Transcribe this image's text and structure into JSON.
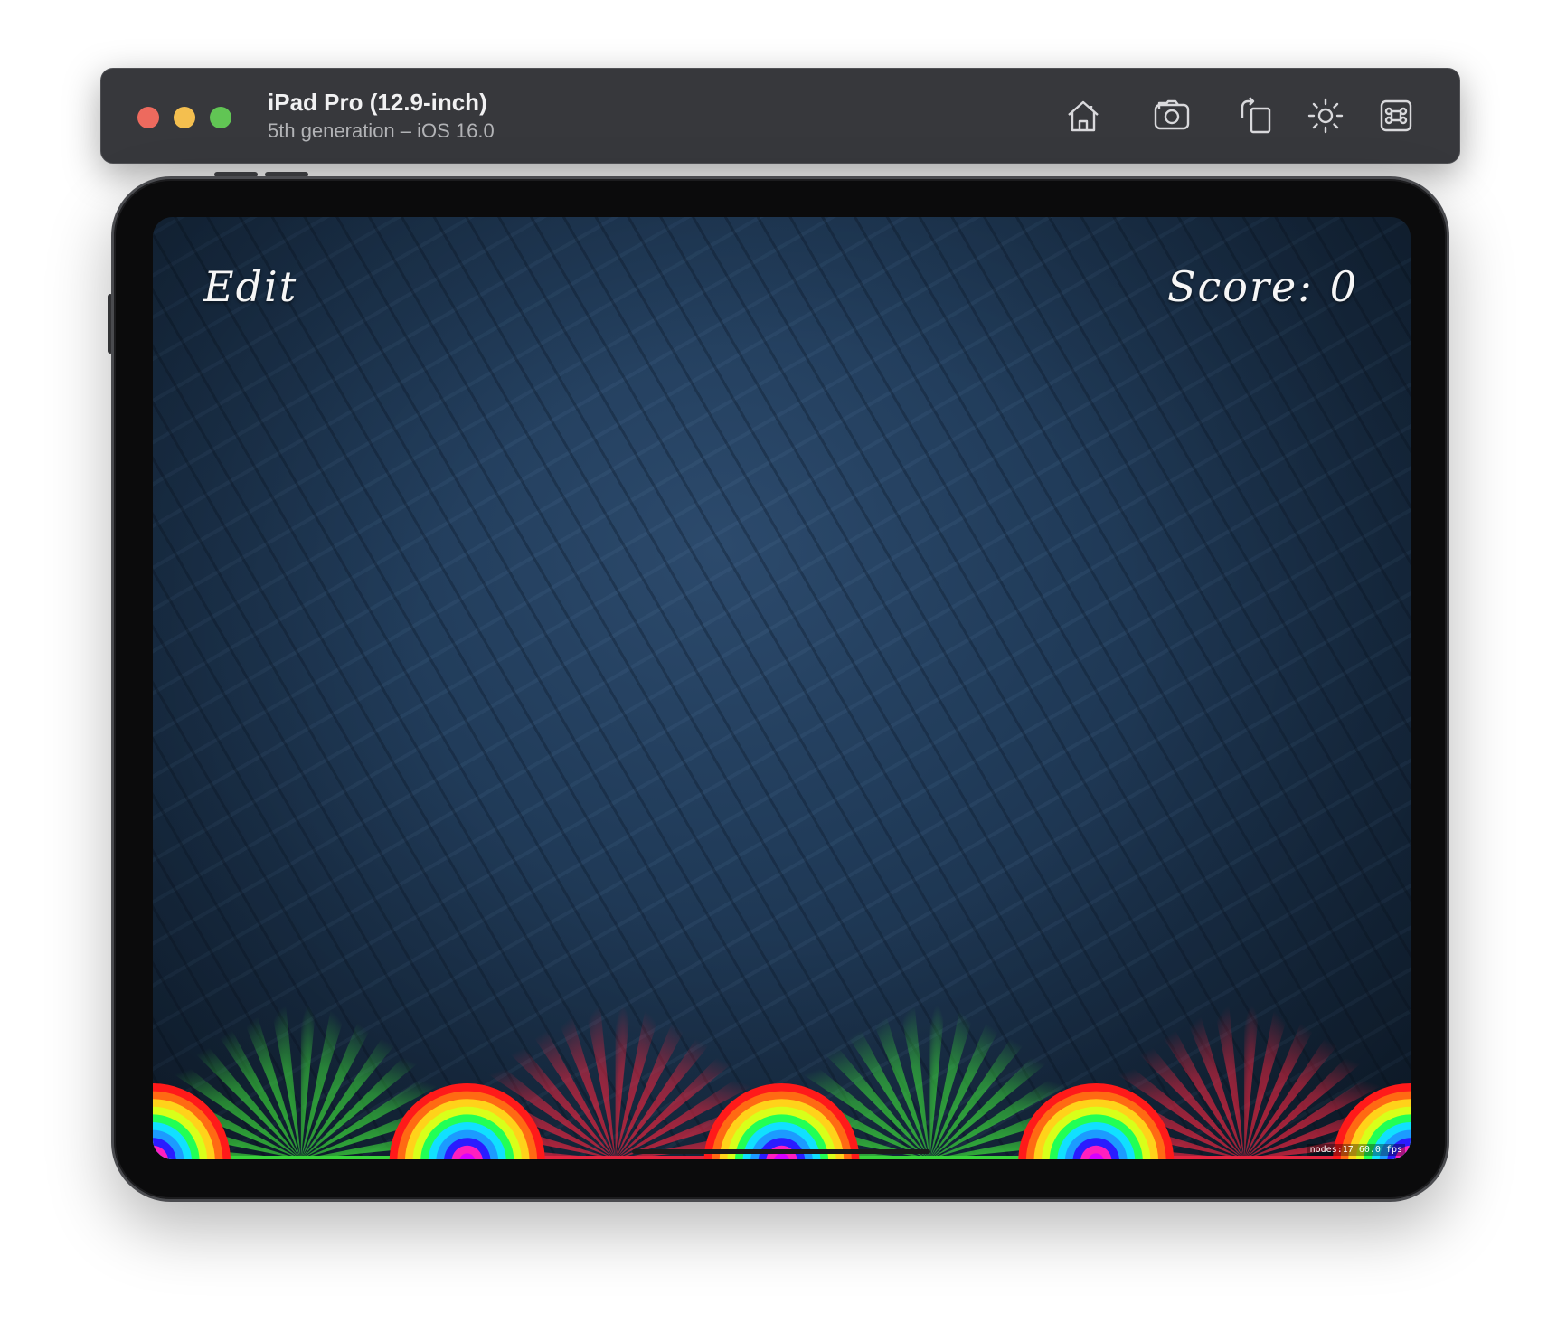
{
  "simulator": {
    "device_name": "iPad Pro (12.9-inch)",
    "device_detail": "5th generation – iOS 16.0",
    "toolbar_icons": [
      "home-icon",
      "screenshot-camera-icon",
      "rotate-icon",
      "appearance-sun-icon",
      "command-icon"
    ],
    "colors": {
      "toolbar_bg": "#37383c",
      "close": "#ed6a5e",
      "minimize": "#f4bf4f",
      "zoom": "#61c554"
    }
  },
  "game": {
    "edit_label": "Edit",
    "score_label": "Score:",
    "score_value": "0",
    "stats_nodes": "nodes:17",
    "stats_fps": "60.0 fps",
    "slot_types": [
      "good",
      "bad",
      "good",
      "bad"
    ],
    "colors": {
      "good_slot": "#3ad43a",
      "bad_slot": "#e3253f",
      "background": "#213c5a"
    }
  }
}
